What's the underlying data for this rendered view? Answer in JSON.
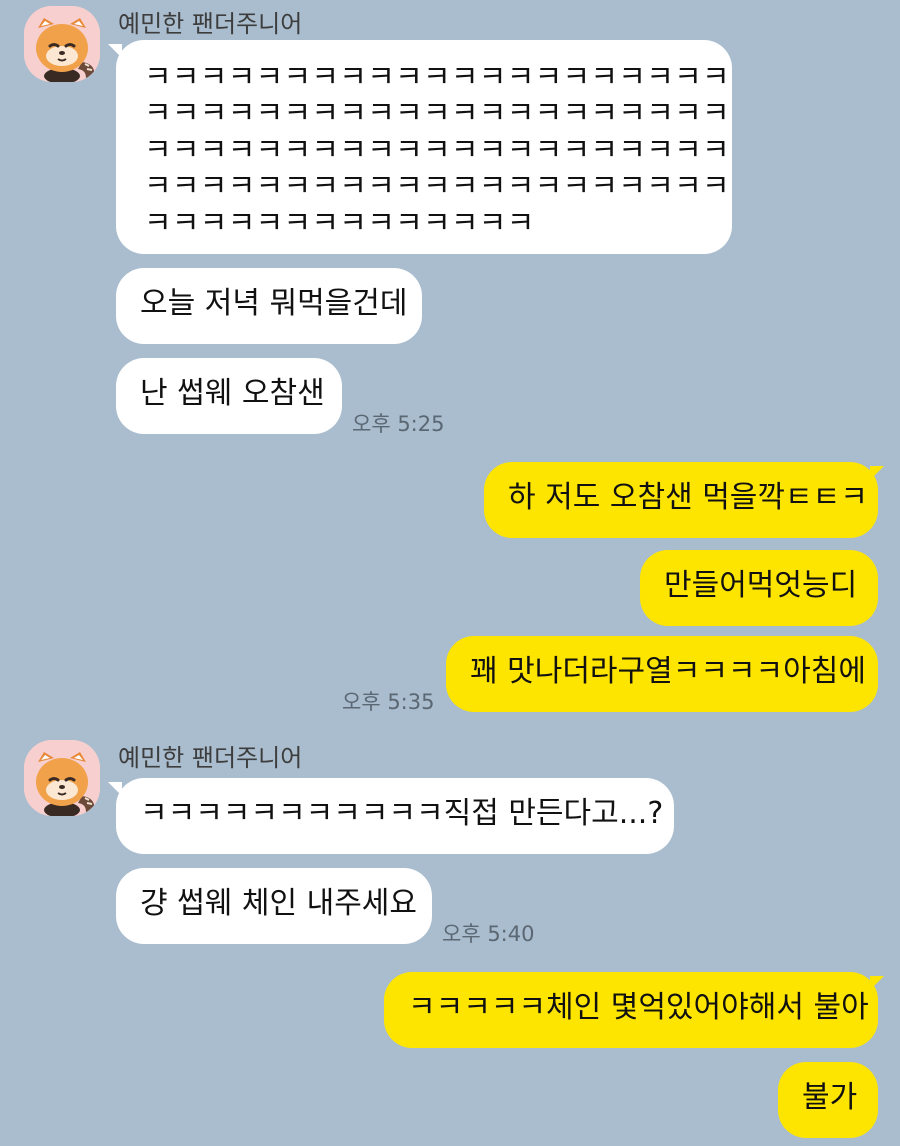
{
  "app": {
    "colors": {
      "background": "#a9bdce",
      "incoming_bubble": "#ffffff",
      "outgoing_bubble": "#fee500",
      "avatar_background": "#f7cfcf"
    }
  },
  "groups": [
    {
      "sender": "예민한 팬더주니어",
      "avatar_icon": "red-panda-icon",
      "messages": [
        {
          "lines": [
            "ㅋㅋㅋㅋㅋㅋㅋㅋㅋㅋㅋㅋㅋㅋㅋㅋㅋㅋㅋㅋㅋ",
            "ㅋㅋㅋㅋㅋㅋㅋㅋㅋㅋㅋㅋㅋㅋㅋㅋㅋㅋㅋㅋㅋ",
            "ㅋㅋㅋㅋㅋㅋㅋㅋㅋㅋㅋㅋㅋㅋㅋㅋㅋㅋㅋㅋㅋ",
            "ㅋㅋㅋㅋㅋㅋㅋㅋㅋㅋㅋㅋㅋㅋㅋㅋㅋㅋㅋㅋㅋ",
            "ㅋㅋㅋㅋㅋㅋㅋㅋㅋㅋㅋㅋㅋㅋ"
          ]
        },
        {
          "text": "오늘 저녁 뭐먹을건데"
        },
        {
          "text": "난 썹웨 오참샌",
          "time": "오후 5:25"
        }
      ]
    },
    {
      "sender": "me",
      "messages": [
        {
          "text": "하 저도 오참샌 먹을깍ㅌㅌㅋ"
        },
        {
          "text": "만들어먹엇능디"
        },
        {
          "text": "꽤 맛나더라구열ㅋㅋㅋㅋ아침에",
          "time": "오후 5:35"
        }
      ]
    },
    {
      "sender": "예민한 팬더주니어",
      "avatar_icon": "red-panda-icon",
      "messages": [
        {
          "text": "ㅋㅋㅋㅋㅋㅋㅋㅋㅋㅋㅋ직접 만든다고...?"
        },
        {
          "text": "걍 썹웨 체인 내주세요",
          "time": "오후 5:40"
        }
      ]
    },
    {
      "sender": "me",
      "messages": [
        {
          "text": "ㅋㅋㅋㅋㅋ체인 몇억있어야해서 불아"
        },
        {
          "text": "불가"
        }
      ]
    }
  ]
}
